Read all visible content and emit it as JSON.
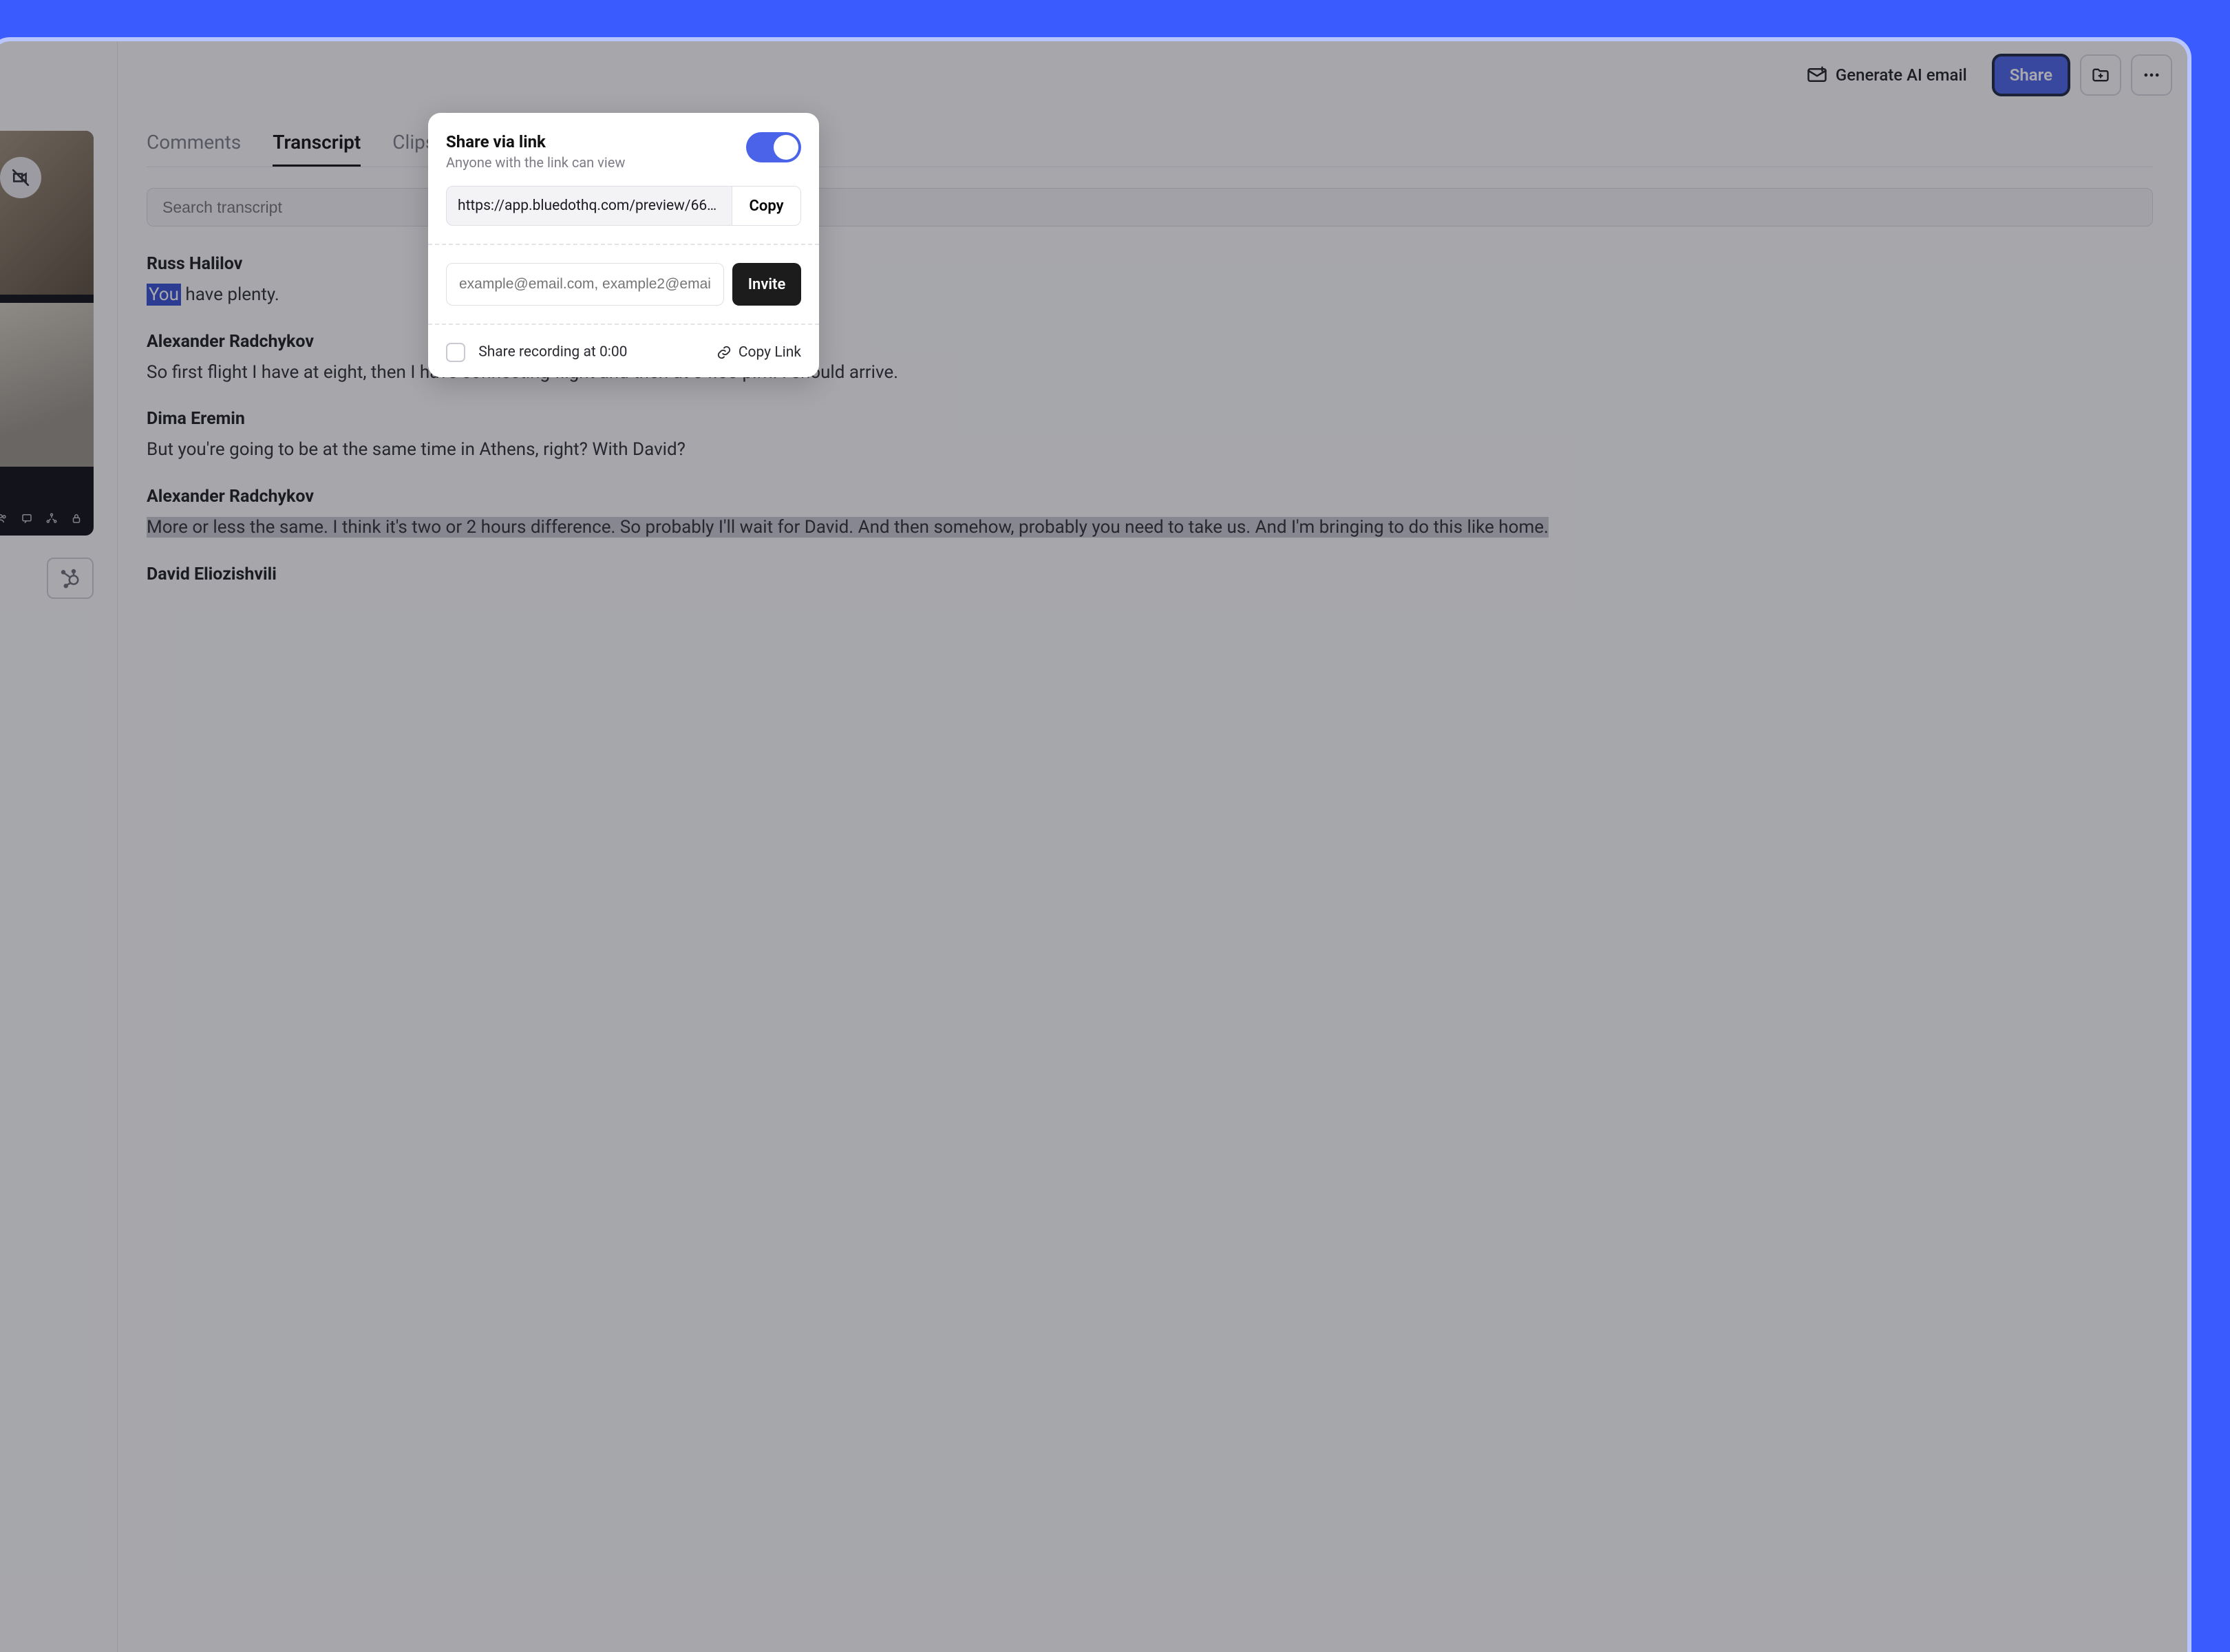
{
  "toolbar": {
    "generate_ai_label": "Generate AI email",
    "share_label": "Share"
  },
  "tabs": {
    "comments": "Comments",
    "transcript": "Transcript",
    "clips": "Clips"
  },
  "search": {
    "placeholder": "Search transcript"
  },
  "transcript": [
    {
      "speaker": "Russ Halilov",
      "segments": [
        {
          "text": "You",
          "style": "highlight-word"
        },
        {
          "text": " have plenty.",
          "style": "plain"
        }
      ]
    },
    {
      "speaker": "Alexander Radchykov",
      "segments": [
        {
          "text": "So first flight I have at eight, then I have connecting flight and then at 04.00 p.m. I should arrive.",
          "style": "plain"
        }
      ]
    },
    {
      "speaker": "Dima Eremin",
      "segments": [
        {
          "text": "But you're going to be at the same time in Athens, right? With David?",
          "style": "plain"
        }
      ]
    },
    {
      "speaker": "Alexander Radchykov",
      "segments": [
        {
          "text": "More or less the same. I think it's two or 2 hours difference. So probably I'll wait for David. And then somehow, probably you need to take us. And I'm bringing to do this like home.",
          "style": "highlight-block"
        }
      ]
    },
    {
      "speaker": "David Eliozishvili",
      "segments": []
    }
  ],
  "share": {
    "title": "Share via link",
    "subtitle": "Anyone with the link can view",
    "link_value": "https://app.bluedothq.com/preview/66…",
    "copy_label": "Copy",
    "invite_placeholder": "example@email.com, example2@emai…",
    "invite_label": "Invite",
    "share_at_label": "Share recording at 0:00",
    "copy_link_label": "Copy Link",
    "toggle_on": true
  }
}
